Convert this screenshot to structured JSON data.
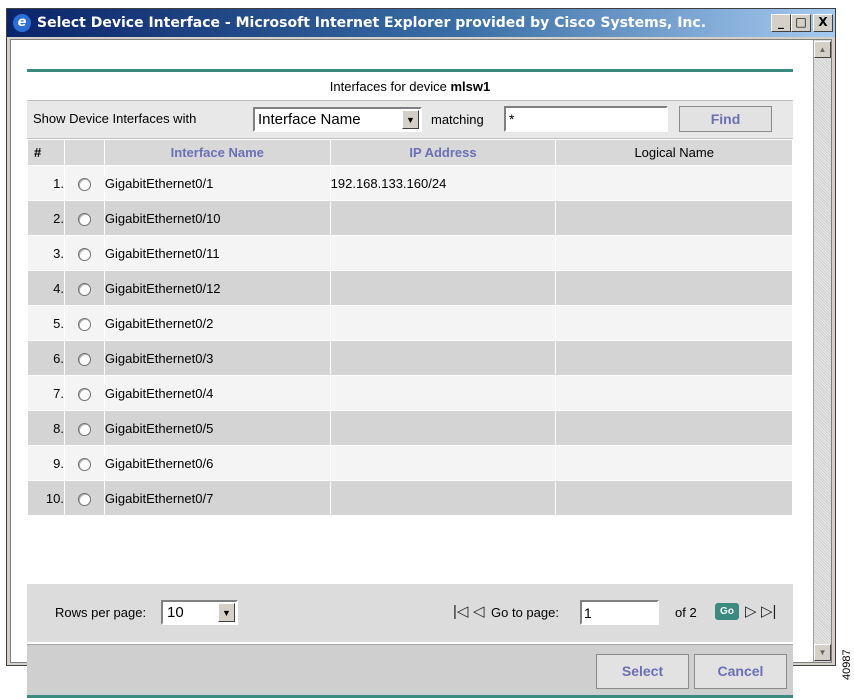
{
  "window": {
    "title": "Select Device Interface - Microsoft Internet Explorer provided by Cisco Systems, Inc.",
    "minimize_label": "_",
    "maximize_label": "□",
    "close_label": "X"
  },
  "panel": {
    "header_prefix": "Interfaces for device ",
    "device_name": "mlsw1"
  },
  "filter": {
    "label": "Show Device Interfaces with",
    "field_selected": "Interface Name",
    "matching_label": "matching",
    "match_value": "*",
    "find_label": "Find"
  },
  "table": {
    "columns": [
      "#",
      "",
      "Interface Name",
      "IP Address",
      "Logical Name"
    ],
    "rows": [
      {
        "num": "1.",
        "name": "GigabitEthernet0/1",
        "ip": "192.168.133.160/24",
        "logical": ""
      },
      {
        "num": "2.",
        "name": "GigabitEthernet0/10",
        "ip": "",
        "logical": ""
      },
      {
        "num": "3.",
        "name": "GigabitEthernet0/11",
        "ip": "",
        "logical": ""
      },
      {
        "num": "4.",
        "name": "GigabitEthernet0/12",
        "ip": "",
        "logical": ""
      },
      {
        "num": "5.",
        "name": "GigabitEthernet0/2",
        "ip": "",
        "logical": ""
      },
      {
        "num": "6.",
        "name": "GigabitEthernet0/3",
        "ip": "",
        "logical": ""
      },
      {
        "num": "7.",
        "name": "GigabitEthernet0/4",
        "ip": "",
        "logical": ""
      },
      {
        "num": "8.",
        "name": "GigabitEthernet0/5",
        "ip": "",
        "logical": ""
      },
      {
        "num": "9.",
        "name": "GigabitEthernet0/6",
        "ip": "",
        "logical": ""
      },
      {
        "num": "10.",
        "name": "GigabitEthernet0/7",
        "ip": "",
        "logical": ""
      }
    ]
  },
  "pager": {
    "rows_per_page_label": "Rows per page:",
    "rows_per_page_value": "10",
    "go_to_label": "Go to page:",
    "current_page": "1",
    "of_label": "of 2",
    "go_label": "Go"
  },
  "footer": {
    "select_label": "Select",
    "cancel_label": "Cancel"
  },
  "figure_id": "40987",
  "colors": {
    "title_bar": "#0a246a",
    "accent_teal": "#3a8a80",
    "header_link": "#6b6fb5"
  }
}
